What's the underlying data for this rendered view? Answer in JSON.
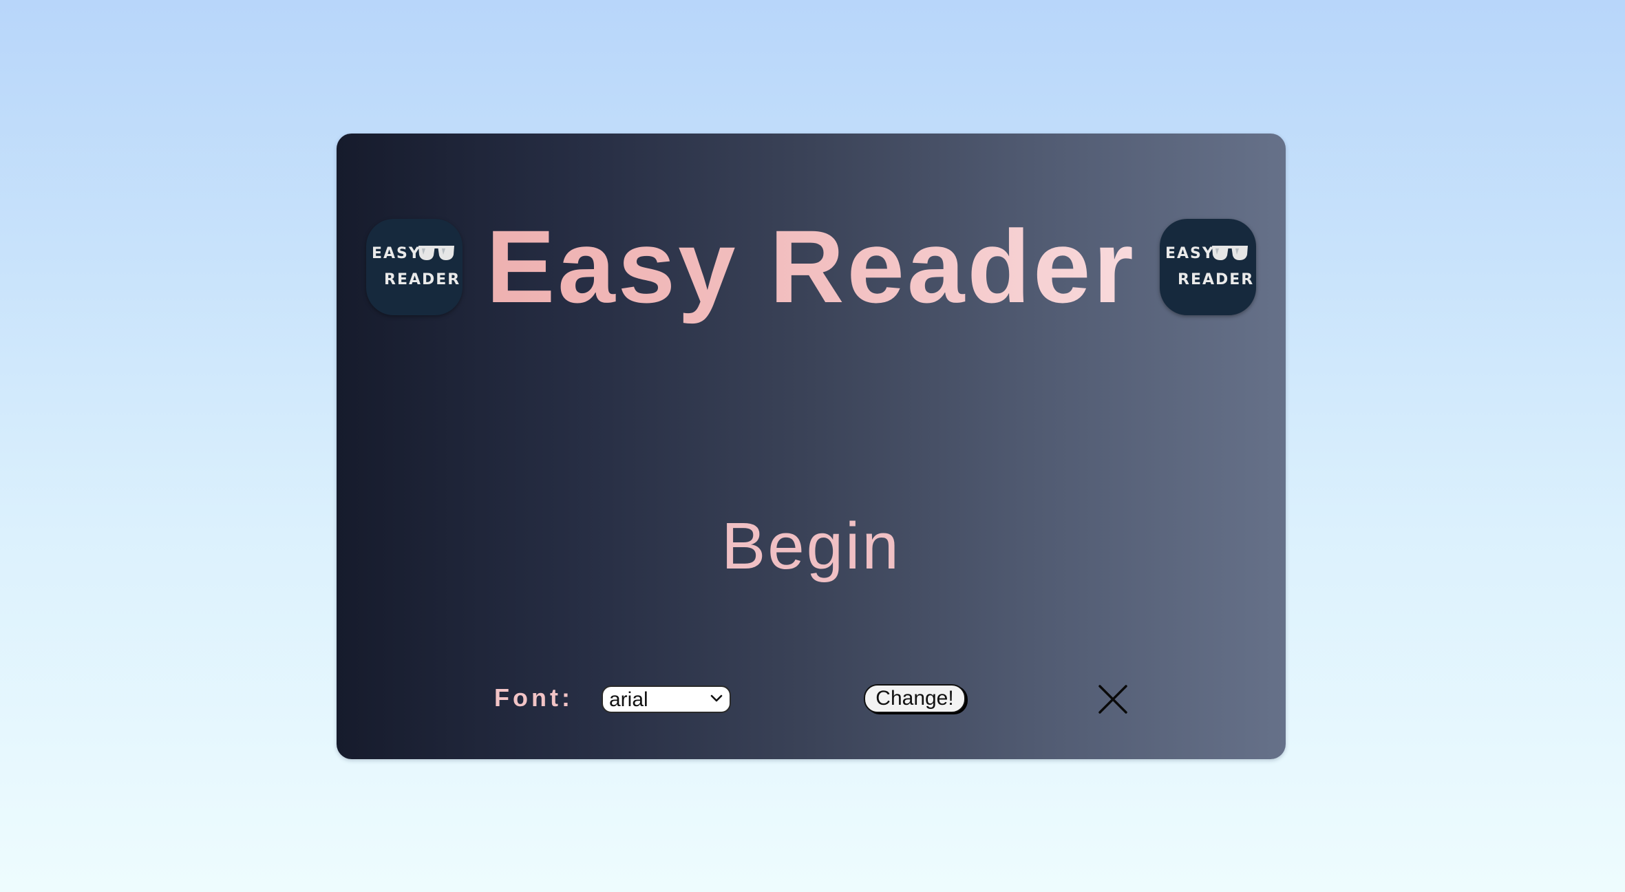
{
  "app": {
    "title": "Easy Reader",
    "begin_label": "Begin"
  },
  "logo": {
    "line1": "EASY",
    "line2": "READER",
    "icon": "sunglasses-icon"
  },
  "controls": {
    "font_label": "Font:",
    "font_select_value": "arial",
    "change_button_label": "Change!",
    "close_icon": "close-icon"
  },
  "colors": {
    "background_top": "#b8d6fa",
    "background_bottom": "#eefcfe",
    "card_left": "#161b2c",
    "card_right": "#667189",
    "title_pink": "#f3c2c3",
    "logo_bg": "#16293d"
  }
}
